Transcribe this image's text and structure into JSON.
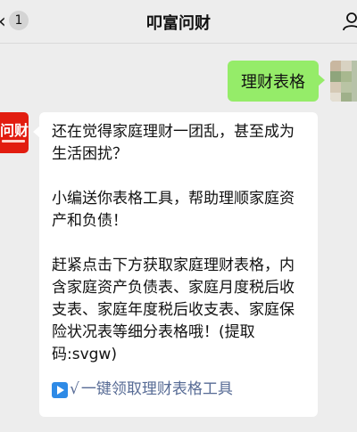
{
  "header": {
    "back_count": "1",
    "title": "叩富问财"
  },
  "messages": [
    {
      "direction": "outgoing",
      "text": "理财表格"
    },
    {
      "direction": "incoming",
      "sender_logo": "问财",
      "paragraphs": [
        "还在觉得家庭理财一团乱，甚至成为生活困扰？",
        "小编送你表格工具，帮助理顺家庭资产和负债！",
        "赶紧点击下方获取家庭理财表格，内含家庭资产负债表、家庭月度税后收支表、家庭年度税后收支表、家庭保险状况表等细分表格哦！(提取码:svgw)"
      ],
      "link_check": "√",
      "link_text": "一键领取理财表格工具"
    }
  ],
  "colors": {
    "outgoing_bubble": "#95ec69",
    "link": "#576b95",
    "background": "#ededed",
    "logo_red": "#e21d10"
  },
  "icons": [
    "back-chevron-icon",
    "profile-icon",
    "play-icon"
  ]
}
